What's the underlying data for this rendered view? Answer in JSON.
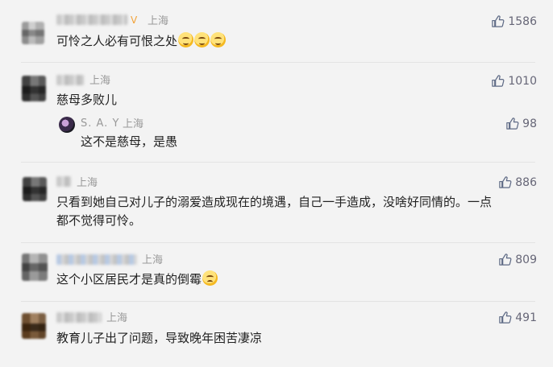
{
  "comments": [
    {
      "location": "上海",
      "vip": "V",
      "text": "可怜之人必有可恨之处",
      "emoji": "smile",
      "likes": "1586"
    },
    {
      "location": "上海",
      "text": "慈母多败儿",
      "likes": "1010",
      "reply": {
        "name": "S. A. Y",
        "location": "上海",
        "text": "这不是慈母，是愚",
        "likes": "98"
      }
    },
    {
      "location": "上海",
      "text_line1": "只看到她自己对儿子的溺爱造成现在的境遇，自己一手造成，没啥好同情的。一点",
      "text_line2": "都不觉得可怜。",
      "likes": "886"
    },
    {
      "location": "上海",
      "text": "这个小区居民才是真的倒霉",
      "emoji": "sad",
      "likes": "809"
    },
    {
      "location": "上海",
      "text": "教育儿子出了问题，导致晚年困苦凄凉",
      "likes": "491"
    }
  ]
}
